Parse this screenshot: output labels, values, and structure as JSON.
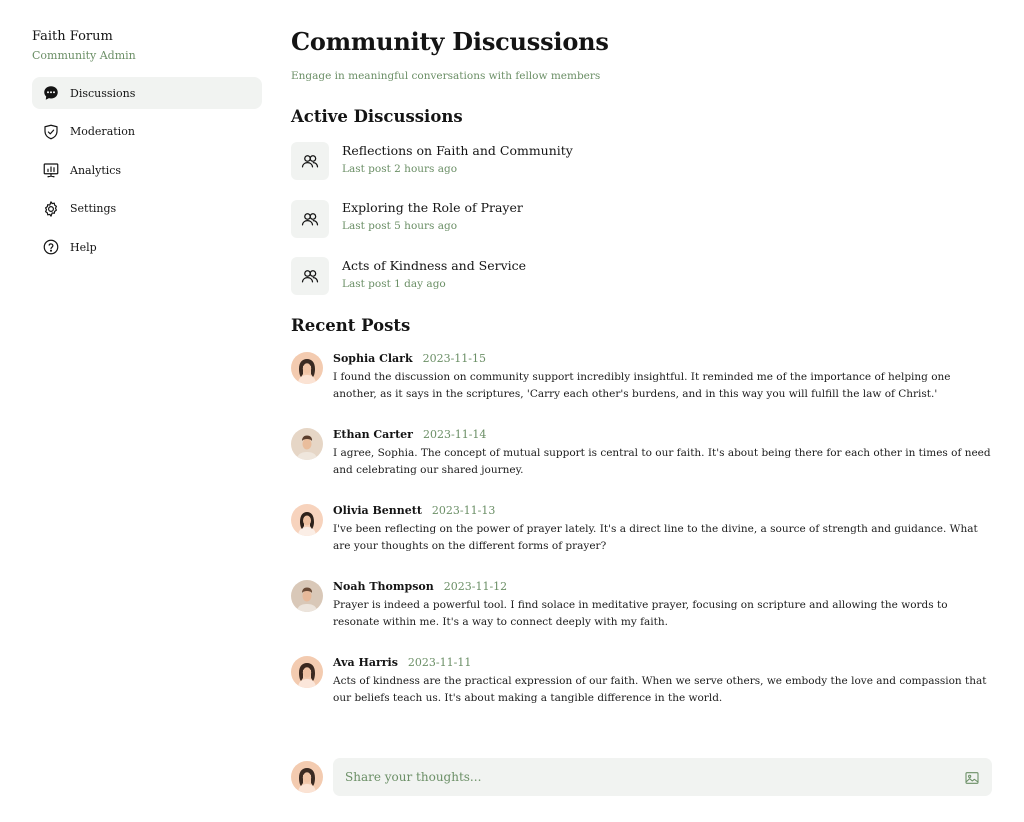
{
  "sidebar": {
    "brand_title": "Faith Forum",
    "brand_subtitle": "Community Admin",
    "items": [
      {
        "label": "Discussions",
        "icon": "chat-bubble-icon",
        "active": true
      },
      {
        "label": "Moderation",
        "icon": "shield-check-icon",
        "active": false
      },
      {
        "label": "Analytics",
        "icon": "presentation-chart-icon",
        "active": false
      },
      {
        "label": "Settings",
        "icon": "gear-icon",
        "active": false
      },
      {
        "label": "Help",
        "icon": "question-circle-icon",
        "active": false
      }
    ]
  },
  "main": {
    "title": "Community Discussions",
    "subtitle": "Engage in meaningful conversations with fellow members",
    "active_section_title": "Active Discussions",
    "discussions": [
      {
        "title": "Reflections on Faith and Community",
        "meta": "Last post 2 hours ago",
        "icon": "users-icon"
      },
      {
        "title": "Exploring the Role of Prayer",
        "meta": "Last post 5 hours ago",
        "icon": "users-icon"
      },
      {
        "title": "Acts of Kindness and Service",
        "meta": "Last post 1 day ago",
        "icon": "users-icon"
      }
    ],
    "recent_section_title": "Recent Posts",
    "posts": [
      {
        "author": "Sophia Clark",
        "date": "2023-11-15",
        "text": "I found the discussion on community support incredibly insightful. It reminded me of the importance of helping one another, as it says in the scriptures, 'Carry each other's burdens, and in this way you will fulfill the law of Christ.'"
      },
      {
        "author": "Ethan Carter",
        "date": "2023-11-14",
        "text": "I agree, Sophia. The concept of mutual support is central to our faith. It's about being there for each other in times of need and celebrating our shared journey."
      },
      {
        "author": "Olivia Bennett",
        "date": "2023-11-13",
        "text": "I've been reflecting on the power of prayer lately. It's a direct line to the divine, a source of strength and guidance. What are your thoughts on the different forms of prayer?"
      },
      {
        "author": "Noah Thompson",
        "date": "2023-11-12",
        "text": "Prayer is indeed a powerful tool. I find solace in meditative prayer, focusing on scripture and allowing the words to resonate within me. It's a way to connect deeply with my faith."
      },
      {
        "author": "Ava Harris",
        "date": "2023-11-11",
        "text": "Acts of kindness are the practical expression of our faith. When we serve others, we embody the love and compassion that our beliefs teach us. It's about making a tangible difference in the world."
      }
    ]
  },
  "composer": {
    "placeholder": "Share your thoughts...",
    "value": "",
    "icon": "image-icon"
  },
  "colors": {
    "accent_green": "#6b8f66",
    "surface": "#f1f3f1",
    "text": "#141414"
  }
}
